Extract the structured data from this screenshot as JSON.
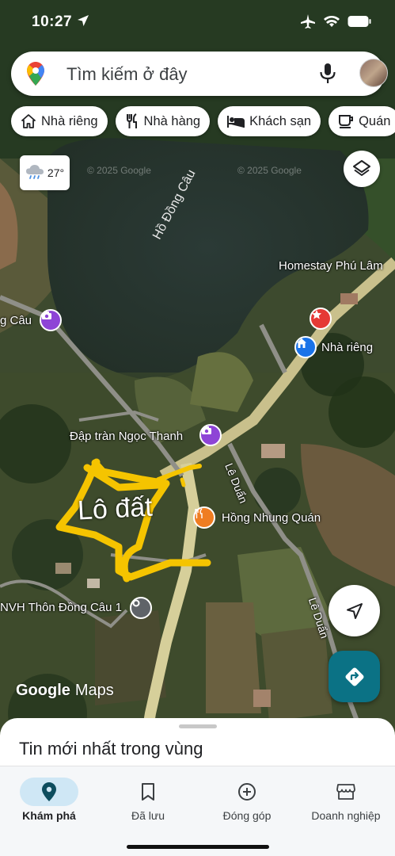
{
  "status_bar": {
    "time": "10:27"
  },
  "search": {
    "placeholder": "Tìm kiếm ở đây"
  },
  "chips": [
    {
      "label": "Nhà riêng",
      "icon": "home-icon"
    },
    {
      "label": "Nhà hàng",
      "icon": "restaurant-icon"
    },
    {
      "label": "Khách sạn",
      "icon": "hotel-icon"
    },
    {
      "label": "Quán",
      "icon": "coffee-icon"
    }
  ],
  "weather": {
    "temp": "27°",
    "icon": "rain-cloud-icon"
  },
  "map": {
    "lake_label": "Hồ Đồng Câu",
    "watermark": "© 2025 Google",
    "places": {
      "homestay": "Homestay Phú Lâm",
      "attraction_left": "g Câu",
      "home": "Nhà riêng",
      "dam": "Đập tràn Ngọc Thanh",
      "restaurant": "Hồng Nhung Quán",
      "cultural_house": "NVH Thôn Đồng Câu 1"
    },
    "roads": {
      "le_duan_1": "Lê Duẩn",
      "le_duan_2": "Lê Duẩn"
    },
    "annotation": "Lô đất",
    "annotation_color": "#f5c400"
  },
  "logo": {
    "google": "Google",
    "maps": "Maps"
  },
  "sheet": {
    "title": "Tin mới nhất trong vùng"
  },
  "nav": [
    {
      "label": "Khám phá",
      "icon": "explore-pin-icon",
      "active": true
    },
    {
      "label": "Đã lưu",
      "icon": "bookmark-icon"
    },
    {
      "label": "Đóng góp",
      "icon": "add-circle-icon"
    },
    {
      "label": "Doanh nghiệp",
      "icon": "storefront-icon"
    }
  ],
  "colors": {
    "accent_teal": "#0b7285",
    "nav_active": "#cfe7f5",
    "poi_purple": "#8e44d6",
    "poi_blue": "#1a73e8",
    "poi_orange": "#ef7d22",
    "poi_red": "#e53935"
  }
}
